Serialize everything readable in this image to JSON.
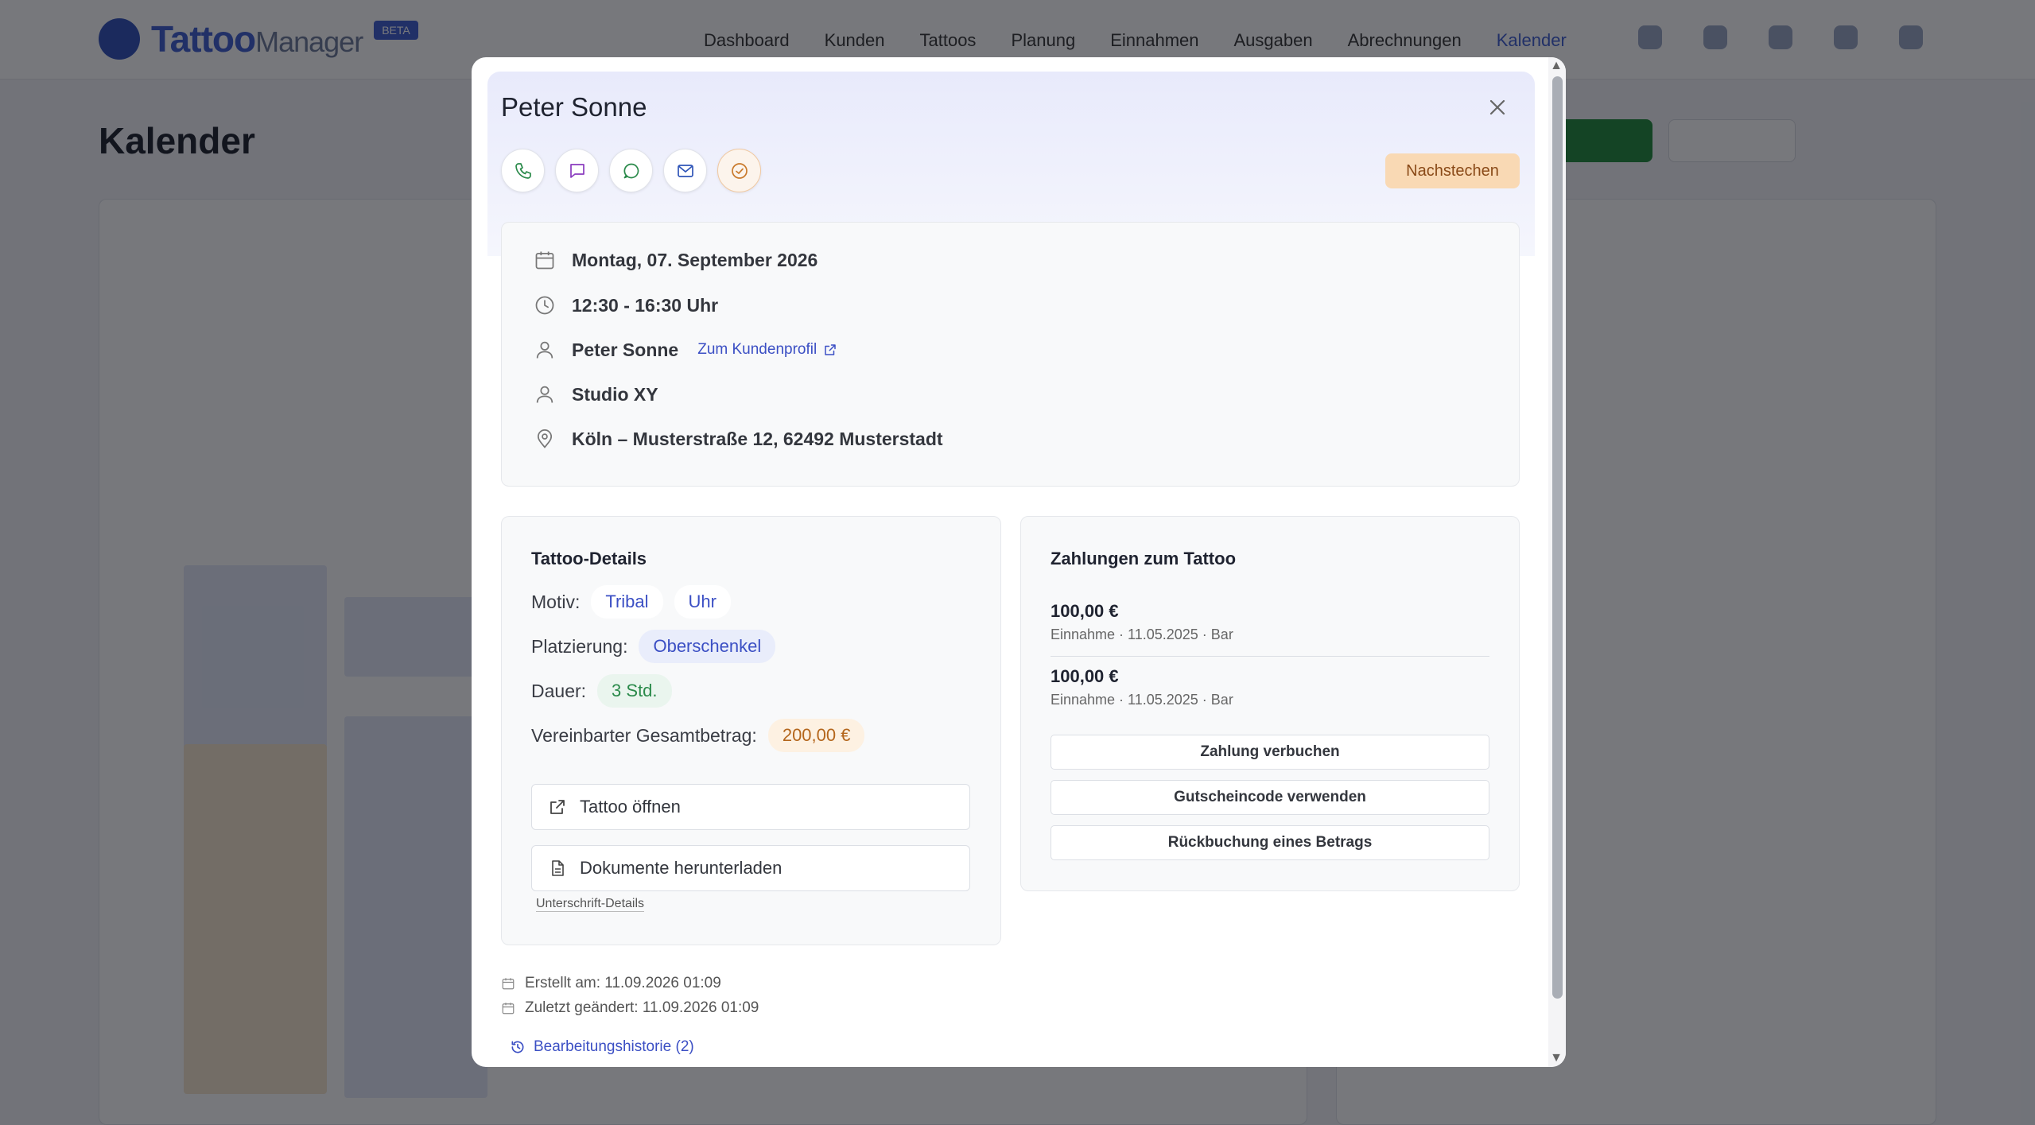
{
  "modal": {
    "title": "Peter Sonne",
    "status_badge": "Nachstechen",
    "appointment": {
      "date": "Montag, 07. September 2026",
      "time": "12:30 - 16:30 Uhr",
      "customer": "Peter Sonne",
      "profile_link": "Zum Kundenprofil",
      "studio": "Studio XY",
      "location": "Köln – Musterstraße 12, 62492 Musterstadt"
    },
    "details": {
      "title": "Tattoo-Details",
      "motiv_label": "Motiv:",
      "motiv": [
        "Tribal",
        "Uhr"
      ],
      "placement_label": "Platzierung:",
      "placement": "Oberschenkel",
      "duration_label": "Dauer:",
      "duration": "3 Std.",
      "total_label": "Vereinbarter Gesamtbetrag:",
      "total": "200,00 €",
      "open_button": "Tattoo öffnen",
      "download_button": "Dokumente herunterladen",
      "signature_link": "Unterschrift-Details"
    },
    "payments": {
      "title": "Zahlungen zum Tattoo",
      "items": [
        {
          "amount": "100,00 €",
          "meta": "Einnahme · 11.05.2025 · Bar"
        },
        {
          "amount": "100,00 €",
          "meta": "Einnahme · 11.05.2025 · Bar"
        }
      ],
      "book_button": "Zahlung verbuchen",
      "voucher_button": "Gutscheincode verwenden",
      "refund_button": "Rückbuchung eines Betrags"
    },
    "footer": {
      "created": "Erstellt am: 11.09.2026 01:09",
      "modified": "Zuletzt geändert: 11.09.2026 01:09",
      "history_link": "Bearbeitungshistorie (2)"
    }
  },
  "colors": {
    "accent": "#3b4fc4",
    "badge_bg": "#f9d9b4",
    "phone": "#2a8a4a",
    "sms": "#8a3bbf",
    "whatsapp": "#2a8a4a",
    "mail": "#2f55b8",
    "status": "#c97a2c"
  }
}
